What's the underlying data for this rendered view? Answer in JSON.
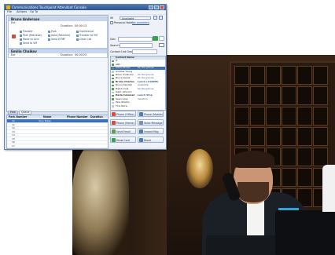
{
  "window": {
    "title": "Communications Touchpoint Attendant Console",
    "menu": [
      "File",
      "Actions",
      "Go To"
    ]
  },
  "calls": [
    {
      "name": "Bruno Anderson",
      "line": "Ext",
      "duration_label": "Duration:",
      "duration": "00:00:13",
      "actions": [
        "Transfer",
        "Park",
        "Conference",
        "Park (Retrieve)",
        "Hold (Retrieve)",
        "Transfer to VM",
        "Move to Line",
        "Send DTMF",
        "Clear Call",
        "Send to VM"
      ]
    },
    {
      "name": "Emilia Chaikov",
      "line": "Ext",
      "duration_label": "Duration:",
      "duration": "00:00:25"
    }
  ],
  "log": {
    "tabs": [
      "Park",
      "Queue"
    ],
    "columns": [
      "Park Number",
      "Name",
      "Phone Number",
      "Duration"
    ],
    "rows": [
      {
        "num": "10",
        "name": "Tony Eldes",
        "phone": "",
        "dur": ""
      },
      {
        "num": "11",
        "name": "",
        "phone": "",
        "dur": ""
      },
      {
        "num": "12",
        "name": "",
        "phone": "",
        "dur": ""
      },
      {
        "num": "13",
        "name": "",
        "phone": "",
        "dur": ""
      },
      {
        "num": "14",
        "name": "",
        "phone": "",
        "dur": ""
      },
      {
        "num": "15",
        "name": "",
        "phone": "",
        "dur": ""
      },
      {
        "num": "16",
        "name": "",
        "phone": "",
        "dur": ""
      },
      {
        "num": "17",
        "name": "",
        "phone": "",
        "dur": ""
      },
      {
        "num": "18",
        "name": "",
        "phone": "",
        "dur": ""
      }
    ]
  },
  "right": {
    "status_label": "IM",
    "status_value": "Available",
    "personal_label": "Personal Note",
    "personal_link": "No comment",
    "dial_label": "Dial",
    "search_label": "Search",
    "contacts_label": "Contact List Groups",
    "contacts_header": "Contact Name",
    "contacts": [
      {
        "name": "IT",
        "status": "",
        "online": true
      },
      {
        "name": "ABC",
        "status": "",
        "online": true
      },
      {
        "name": "Adam Brown",
        "status": "On the phone",
        "online": true,
        "selected": true
      },
      {
        "name": "Andrew Young",
        "status": "",
        "online": false
      },
      {
        "name": "Brian Anderson",
        "status": "On the phone",
        "online": true
      },
      {
        "name": "Bruce Kozak",
        "status": "On the phone",
        "online": true
      },
      {
        "name": "Bruno Charles",
        "status": "Lunch (2:00PM)",
        "online": true
      },
      {
        "name": "Bruno Kendall",
        "status": "Available",
        "online": true
      },
      {
        "name": "Hatch Cole",
        "status": "On the phone",
        "online": true
      },
      {
        "name": "Isaac Johnson",
        "status": "",
        "online": false
      },
      {
        "name": "Karla Coleman",
        "status": "Lunch Stop",
        "online": true
      },
      {
        "name": "Sean Gray",
        "status": "Vacation",
        "online": true
      },
      {
        "name": "Tara Sharko",
        "status": "",
        "online": false
      },
      {
        "name": "Tino Noris",
        "status": "",
        "online": false
      }
    ],
    "buttons": [
      "Phone (Office)",
      "Phone (Mobile)",
      "Phone (Home)",
      "Voice Message",
      "Send Email",
      "Instant Msg",
      "Draw Cord",
      "Reset"
    ]
  }
}
